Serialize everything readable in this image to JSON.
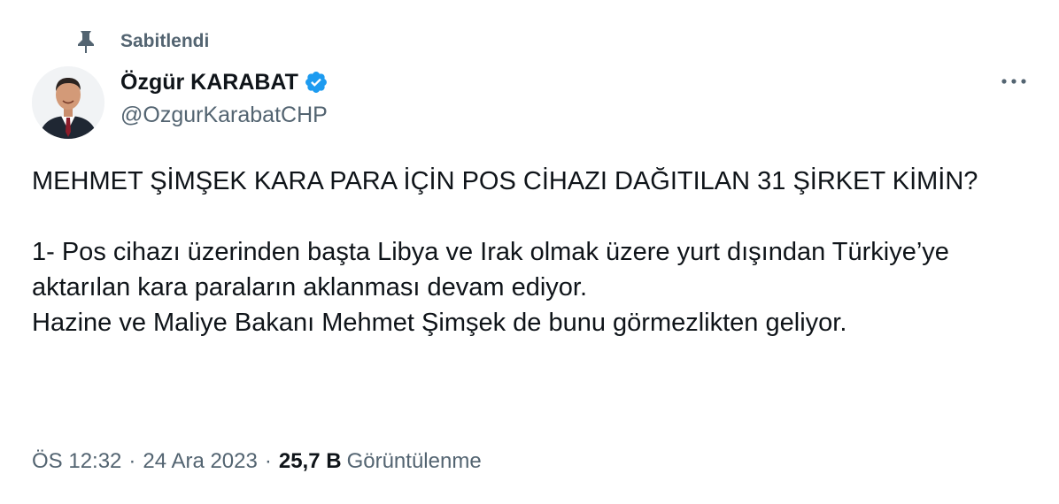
{
  "pinned": {
    "label": "Sabitlendi",
    "icon": "pin-icon"
  },
  "author": {
    "display_name": "Özgür KARABAT",
    "handle": "@OzgurKarabatCHP",
    "verified": true,
    "verified_color": "#1d9bf0"
  },
  "more_icon": "more-horizontal-icon",
  "tweet": {
    "text": "MEHMET ŞİMŞEK KARA PARA İÇİN POS CİHAZI DAĞITILAN 31 ŞİRKET KİMİN?\n\n1- Pos cihazı üzerinden başta Libya ve Irak olmak üzere yurt dışından Türkiye’ye aktarılan kara paraların aklanması devam ediyor.\nHazine ve Maliye Bakanı Mehmet Şimşek de bunu görmezlikten geliyor."
  },
  "meta": {
    "time": "ÖS 12:32",
    "separator": "·",
    "date": "24 Ara 2023",
    "views_count": "25,7 B",
    "views_label": "Görüntülenme"
  },
  "colors": {
    "text_primary": "#0f1419",
    "text_secondary": "#536471",
    "background": "#ffffff"
  }
}
